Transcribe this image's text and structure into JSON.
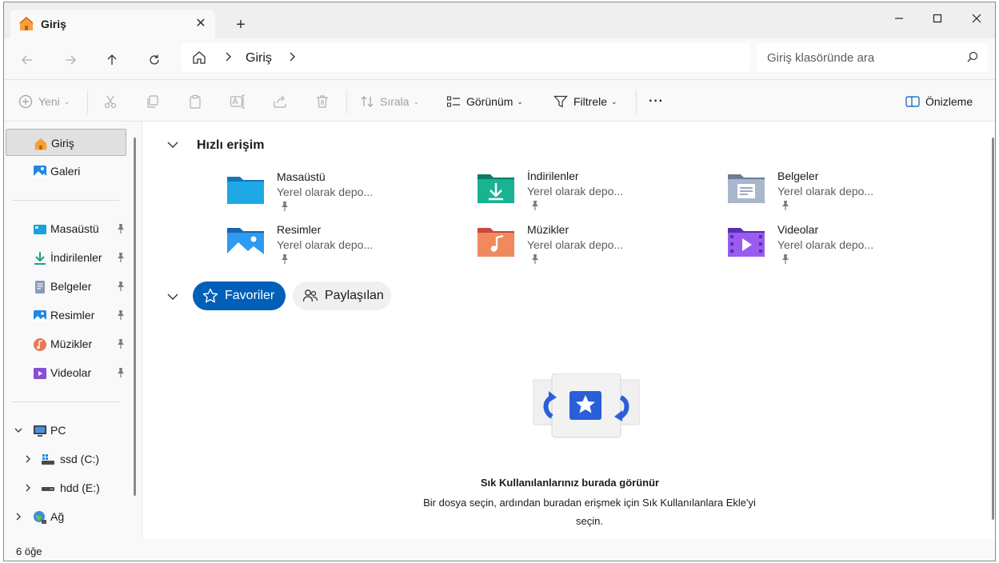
{
  "window": {
    "tab_title": "Giriş",
    "close_tab": "✕",
    "new_tab": "+"
  },
  "address": {
    "crumb": "Giriş"
  },
  "search": {
    "placeholder": "Giriş klasöründe ara"
  },
  "toolbar": {
    "new_label": "Yeni",
    "sort_label": "Sırala",
    "view_label": "Görünüm",
    "filter_label": "Filtrele",
    "more_label": "···",
    "preview_label": "Önizleme"
  },
  "sidebar": {
    "top": [
      {
        "label": "Giriş",
        "icon": "home-icon"
      },
      {
        "label": "Galeri",
        "icon": "gallery-icon"
      }
    ],
    "pinned": [
      {
        "label": "Masaüstü",
        "icon": "desktop-icon"
      },
      {
        "label": "İndirilenler",
        "icon": "downloads-icon"
      },
      {
        "label": "Belgeler",
        "icon": "documents-icon"
      },
      {
        "label": "Resimler",
        "icon": "pictures-icon"
      },
      {
        "label": "Müzikler",
        "icon": "music-icon"
      },
      {
        "label": "Videolar",
        "icon": "videos-icon"
      }
    ],
    "pc": {
      "label": "PC",
      "icon": "pc-icon"
    },
    "drives": [
      {
        "label": "ssd (C:)",
        "icon": "drive-icon"
      },
      {
        "label": "hdd (E:)",
        "icon": "drive-icon"
      }
    ],
    "network": {
      "label": "Ağ",
      "icon": "network-icon"
    }
  },
  "main": {
    "quick_access_title": "Hızlı erişim",
    "folders": [
      {
        "name": "Masaüstü",
        "sub": "Yerel olarak depo...",
        "icon": "desktop-folder-icon"
      },
      {
        "name": "İndirilenler",
        "sub": "Yerel olarak depo...",
        "icon": "downloads-folder-icon"
      },
      {
        "name": "Belgeler",
        "sub": "Yerel olarak depo...",
        "icon": "documents-folder-icon"
      },
      {
        "name": "Resimler",
        "sub": "Yerel olarak depo...",
        "icon": "pictures-folder-icon"
      },
      {
        "name": "Müzikler",
        "sub": "Yerel olarak depo...",
        "icon": "music-folder-icon"
      },
      {
        "name": "Videolar",
        "sub": "Yerel olarak depo...",
        "icon": "videos-folder-icon"
      }
    ],
    "tabs": {
      "favorites": "Favoriler",
      "shared": "Paylaşılan"
    },
    "empty_title": "Sık Kullanılanlarınız burada görünür",
    "empty_desc": "Bir dosya seçin, ardından buradan erişmek için Sık Kullanılanlara Ekle'yi seçin."
  },
  "status": {
    "count": "6 öğe"
  },
  "colors": {
    "accent": "#005fb8",
    "selected_bg": "#e0e0e0"
  }
}
